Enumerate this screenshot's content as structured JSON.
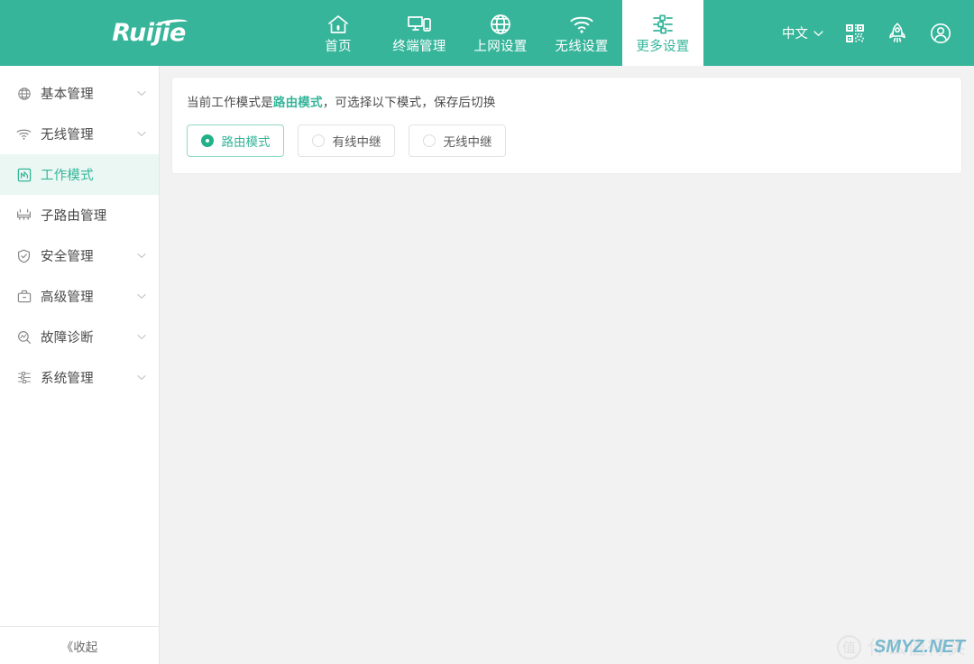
{
  "header": {
    "brand": "Ruijie",
    "nav": [
      {
        "label": "首页",
        "icon": "home-icon",
        "active": false
      },
      {
        "label": "终端管理",
        "icon": "devices-icon",
        "active": false
      },
      {
        "label": "上网设置",
        "icon": "globe-icon",
        "active": false
      },
      {
        "label": "无线设置",
        "icon": "wifi-icon",
        "active": false
      },
      {
        "label": "更多设置",
        "icon": "sliders-icon",
        "active": true
      }
    ],
    "language": "中文",
    "icons": [
      {
        "name": "qrcode-icon"
      },
      {
        "name": "rocket-icon"
      },
      {
        "name": "user-account-icon"
      }
    ]
  },
  "sidebar": {
    "items": [
      {
        "label": "基本管理",
        "icon": "globe-icon",
        "expandable": true,
        "active": false
      },
      {
        "label": "无线管理",
        "icon": "wifi-icon",
        "expandable": true,
        "active": false
      },
      {
        "label": "工作模式",
        "icon": "workmode-icon",
        "expandable": false,
        "active": true
      },
      {
        "label": "子路由管理",
        "icon": "sub-router-icon",
        "expandable": false,
        "active": false
      },
      {
        "label": "安全管理",
        "icon": "shield-check-icon",
        "expandable": true,
        "active": false
      },
      {
        "label": "高级管理",
        "icon": "briefcase-icon",
        "expandable": true,
        "active": false
      },
      {
        "label": "故障诊断",
        "icon": "magnifier-icon",
        "expandable": true,
        "active": false
      },
      {
        "label": "系统管理",
        "icon": "sliders-icon",
        "expandable": true,
        "active": false
      }
    ],
    "collapse_label": "《收起"
  },
  "main": {
    "description_prefix": "当前工作模式是",
    "description_highlight": "路由模式",
    "description_suffix": "，可选择以下模式，保存后切换",
    "modes": [
      {
        "label": "路由模式",
        "selected": true
      },
      {
        "label": "有线中继",
        "selected": false
      },
      {
        "label": "无线中继",
        "selected": false
      }
    ]
  },
  "watermark": {
    "badge": "值",
    "text": "什么值得买",
    "site": "SMYZ.NET"
  },
  "colors": {
    "brand_green": "#36b59a",
    "accent_green": "#20b189",
    "active_bg": "#eaf7f3",
    "page_bg": "#f2f2f2",
    "watermark_blue": "#7ab9cf"
  }
}
